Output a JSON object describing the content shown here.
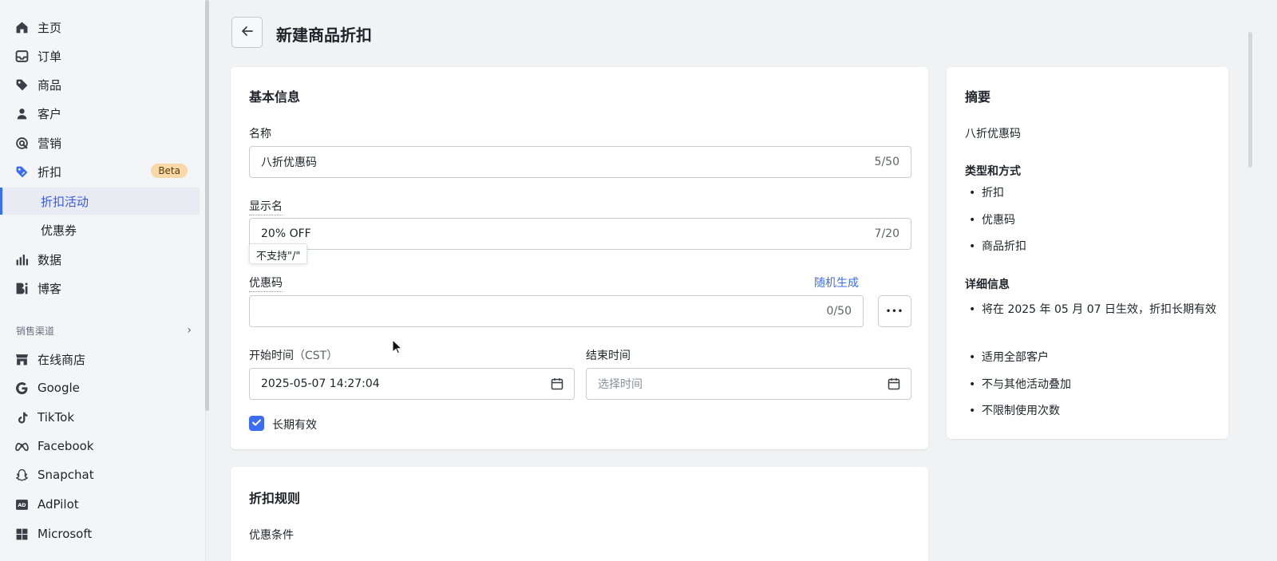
{
  "sidebar": {
    "items": [
      {
        "label": "主页",
        "icon": "home-icon"
      },
      {
        "label": "订单",
        "icon": "inbox-icon"
      },
      {
        "label": "商品",
        "icon": "tag-icon"
      },
      {
        "label": "客户",
        "icon": "person-icon"
      },
      {
        "label": "营销",
        "icon": "target-icon"
      },
      {
        "label": "折扣",
        "icon": "discount-tag-icon",
        "badge": "Beta"
      },
      {
        "label": "数据",
        "icon": "bar-chart-icon"
      },
      {
        "label": "博客",
        "icon": "blog-icon"
      }
    ],
    "subitems": [
      {
        "label": "折扣活动",
        "active": true
      },
      {
        "label": "优惠券",
        "active": false
      }
    ],
    "section_label": "销售渠道",
    "channels": [
      {
        "label": "在线商店",
        "icon": "store-icon"
      },
      {
        "label": "Google",
        "icon": "google-icon"
      },
      {
        "label": "TikTok",
        "icon": "tiktok-icon"
      },
      {
        "label": "Facebook",
        "icon": "meta-icon"
      },
      {
        "label": "Snapchat",
        "icon": "snapchat-icon"
      },
      {
        "label": "AdPilot",
        "icon": "adpilot-icon"
      },
      {
        "label": "Microsoft",
        "icon": "microsoft-icon"
      }
    ]
  },
  "header": {
    "title": "新建商品折扣"
  },
  "basic_info": {
    "title": "基本信息",
    "name_label": "名称",
    "name_value": "八折优惠码",
    "name_counter": "5/50",
    "display_label": "显示名",
    "display_value": "20% OFF",
    "display_counter": "7/20",
    "tooltip": "不支持\"/\"",
    "code_label": "优惠码",
    "code_random_link": "随机生成",
    "code_counter": "0/50",
    "more_label": "•••",
    "start_label": "开始时间",
    "start_tz": "（CST）",
    "start_value": "2025-05-07 14:27:04",
    "end_label": "结束时间",
    "end_placeholder": "选择时间",
    "long_term_label": "长期有效",
    "long_term_checked": true
  },
  "rules": {
    "title": "折扣规则",
    "condition_label": "优惠条件"
  },
  "summary": {
    "title": "摘要",
    "name": "八折优惠码",
    "type_heading": "类型和方式",
    "type_items": [
      "折扣",
      "优惠码",
      "商品折扣"
    ],
    "detail_heading": "详细信息",
    "detail_items": [
      "将在 2025 年 05 月 07 日生效，折扣长期有效",
      "适用全部客户",
      "不与其他活动叠加",
      "不限制使用次数"
    ]
  },
  "colors": {
    "accent": "#3b6cf6",
    "badge_bg": "#f9d8a8",
    "page_bg": "#f1f2f4"
  }
}
